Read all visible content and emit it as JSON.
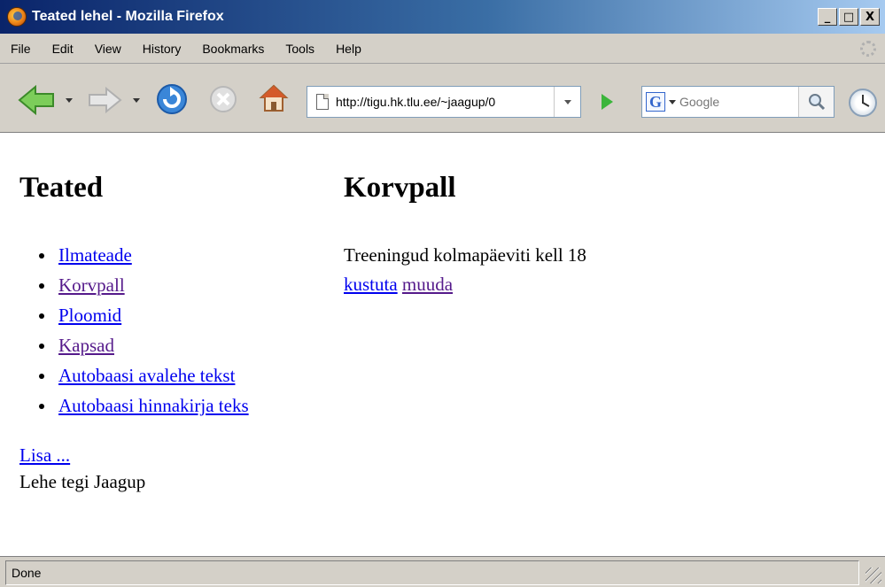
{
  "window": {
    "title": "Teated lehel - Mozilla Firefox",
    "controls": [
      "_",
      "□",
      "X"
    ]
  },
  "menu": {
    "items": [
      "File",
      "Edit",
      "View",
      "History",
      "Bookmarks",
      "Tools",
      "Help"
    ]
  },
  "toolbar": {
    "url": "http://tigu.hk.tlu.ee/~jaagup/0",
    "search_placeholder": "Google",
    "search_engine_letter": "G"
  },
  "page": {
    "left_heading": "Teated",
    "items": [
      {
        "label": "Ilmateade",
        "visited": false
      },
      {
        "label": "Korvpall",
        "visited": true
      },
      {
        "label": "Ploomid",
        "visited": false
      },
      {
        "label": "Kapsad",
        "visited": true
      },
      {
        "label": "Autobaasi avalehe tekst",
        "visited": false
      },
      {
        "label": "Autobaasi hinnakirja teks",
        "visited": false
      }
    ],
    "add_link": "Lisa ...",
    "footer": "Lehe tegi Jaagup",
    "right_heading": "Korvpall",
    "body": "Treeningud kolmapäeviti kell 18",
    "delete_link": "kustuta",
    "edit_link": "muuda"
  },
  "status": {
    "text": "Done"
  },
  "colors": {
    "link": "#0000ee",
    "visited_link": "#551a8b",
    "chrome": "#d4d0c8"
  }
}
